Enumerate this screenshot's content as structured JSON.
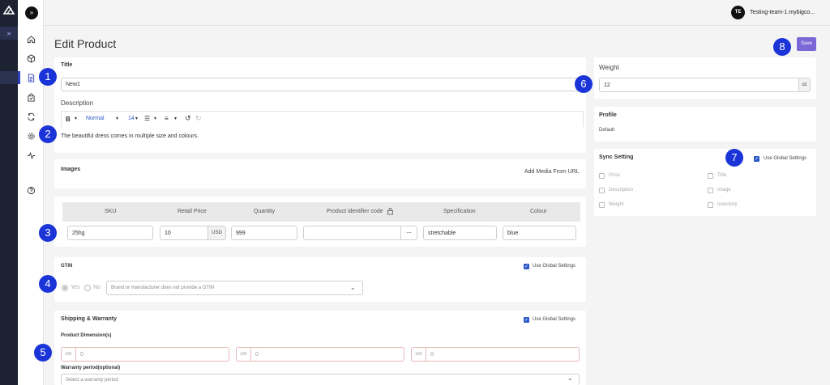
{
  "header": {
    "avatar_initials": "TE",
    "store_name": "Testing-team-1.mybigco...",
    "page_title": "Edit Product",
    "save_label": "Save"
  },
  "sidebar": {
    "icons": [
      "home-icon",
      "box-icon",
      "document-icon",
      "bag-icon",
      "sync-icon",
      "gear-icon",
      "activity-icon",
      "help-icon"
    ]
  },
  "title_section": {
    "title_label": "Title",
    "title_value": "New1",
    "description_label": "Description",
    "toolbar": {
      "bold": "B",
      "style": "Normal",
      "size": "14"
    },
    "description_text": "The beautiful dress comes in multiple size and colours."
  },
  "images": {
    "label": "Images",
    "add_media": "Add Media From URL"
  },
  "variants": {
    "headers": [
      "SKU",
      "Retail Price",
      "Quantity",
      "Product identifier code",
      "Specification",
      "Colour"
    ],
    "row": {
      "sku": "25hg",
      "price": "10",
      "currency": "USD",
      "quantity": "999",
      "identifier": "",
      "identifier_action": "---",
      "specification": "stretchable",
      "colour": "blue"
    }
  },
  "gtin": {
    "label": "GTIN",
    "use_global": "Use Global Settings",
    "yes": "Yes",
    "no": "No",
    "select": "Brand or manufacturer does not provide a GTIN"
  },
  "shipping": {
    "label": "Shipping & Warranty",
    "use_global": "Use Global Settings",
    "dimension_label": "Product Dimension(s)",
    "dims": [
      {
        "unit": "cm",
        "value": "0"
      },
      {
        "unit": "cm",
        "value": "0"
      },
      {
        "unit": "cm",
        "value": "0"
      }
    ],
    "warranty_label": "Warranty period(optional)",
    "warranty_placeholder": "Select a warranty period"
  },
  "weight": {
    "label": "Weight",
    "value": "12",
    "unit": "oz"
  },
  "profile": {
    "label": "Profile",
    "value": "Default"
  },
  "sync": {
    "label": "Sync Setting",
    "use_global": "Use Global Settings",
    "options": [
      "Price",
      "Title",
      "Description",
      "Image",
      "Weight",
      "Inventory"
    ]
  },
  "badges": [
    "1",
    "2",
    "3",
    "4",
    "5",
    "6",
    "7",
    "8"
  ]
}
